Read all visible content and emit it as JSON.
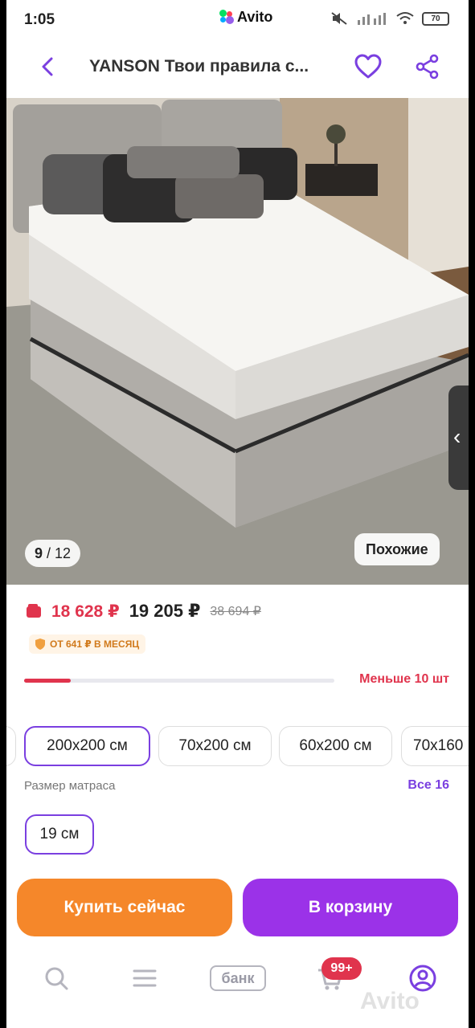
{
  "status_bar": {
    "time": "1:05",
    "app_pill": "Avito",
    "battery": "70"
  },
  "header": {
    "title": "YANSON Твои правила с..."
  },
  "gallery": {
    "current": "9",
    "total": "12",
    "similar_label": "Похожие"
  },
  "price": {
    "card_price": "18 628 ₽",
    "price": "19 205 ₽",
    "old_price": "38 694 ₽",
    "installment": "ОТ 641 ₽ В МЕСЯЦ"
  },
  "stock": {
    "label": "Меньше 10 шт",
    "fill_fraction": 0.15
  },
  "sizes": {
    "options": [
      "200x200 см",
      "70x200 см",
      "60x200 см",
      "70x160"
    ],
    "selected_index": 0,
    "label": "Размер матраса",
    "all_link": "Все 16"
  },
  "thickness": {
    "selected": "19 см"
  },
  "actions": {
    "buy_now": "Купить сейчас",
    "to_cart": "В корзину"
  },
  "nav": {
    "bank_label": "банк",
    "cart_badge": "99+"
  },
  "watermark": "Avito",
  "colors": {
    "accent_purple": "#7a3fe0",
    "buy_orange": "#f5872a",
    "cart_purple": "#9b32e8",
    "price_red": "#e0344d"
  },
  "icons": [
    "back-arrow-icon",
    "heart-icon",
    "share-icon",
    "wallet-icon",
    "shield-icon",
    "search-icon",
    "menu-icon",
    "cart-icon",
    "profile-icon"
  ]
}
